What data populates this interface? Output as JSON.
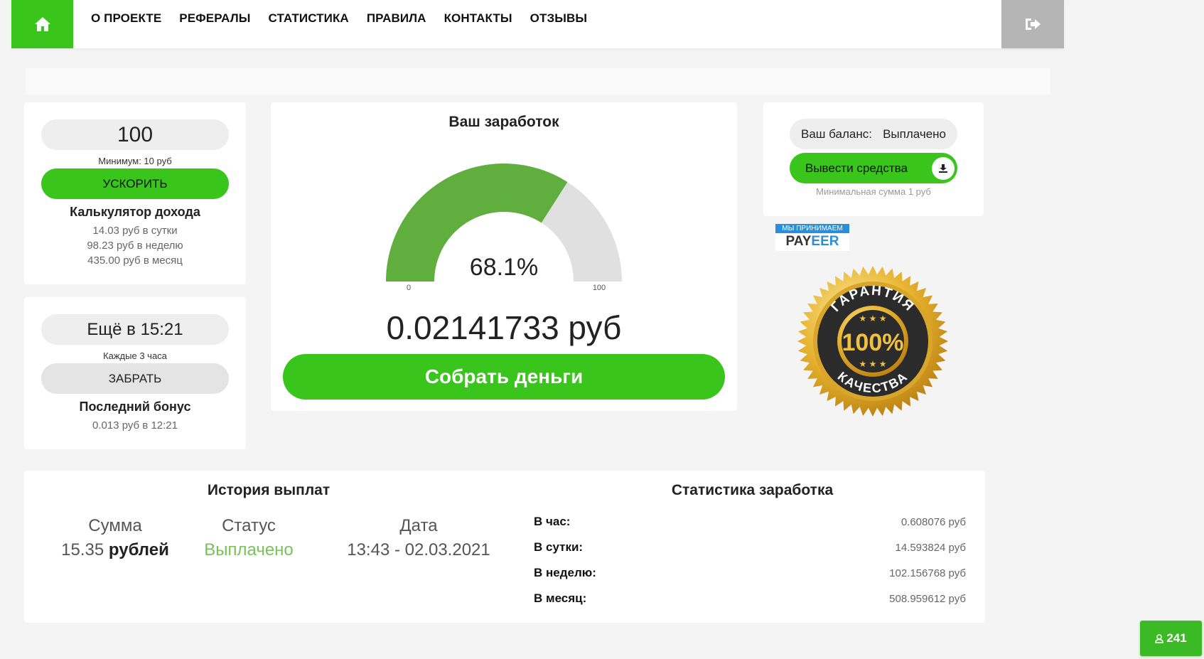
{
  "nav": {
    "home_icon": "home-icon",
    "items": [
      "О ПРОЕКТЕ",
      "РЕФЕРАЛЫ",
      "СТАТИСТИКА",
      "ПРАВИЛА",
      "КОНТАКТЫ",
      "ОТЗЫВЫ"
    ],
    "logout_icon": "sign-out-icon"
  },
  "boost": {
    "value": "100",
    "min_note": "Минимум: 10 руб",
    "button": "УСКОРИТЬ",
    "calc_title": "Калькулятор дохода",
    "per_day": "14.03 руб в сутки",
    "per_week": "98.23 руб в неделю",
    "per_month": "435.00 руб в месяц"
  },
  "bonus": {
    "timer": "Ещё в 15:21",
    "period_note": "Каждые 3 часа",
    "button": "ЗАБРАТЬ",
    "last_title": "Последний бонус",
    "last_value": "0.013 руб в 12:21"
  },
  "earnings": {
    "title": "Ваш заработок",
    "gauge_percent": 68.1,
    "gauge_label": "68.1%",
    "gauge_min": "0",
    "gauge_max": "100",
    "amount": "0.02141733 руб",
    "collect_button": "Собрать деньги",
    "colors": {
      "fill": "#5fae3e",
      "track": "#e0e0e0"
    }
  },
  "balance": {
    "label": "Ваш баланс:",
    "paid_label": "Выплачено",
    "withdraw_button": "Вывести средства",
    "withdraw_icon": "download-icon",
    "min_note": "Минимальная сумма 1 руб"
  },
  "payeer": {
    "top": "МЫ ПРИНИМАЕМ",
    "brand_a": "PAY",
    "brand_b": "EER"
  },
  "guarantee": {
    "top_text": "ГАРАНТИЯ",
    "center_text": "100%",
    "bottom_text": "КАЧЕСТВА"
  },
  "history": {
    "title": "История выплат",
    "columns": [
      "Сумма",
      "Статус",
      "Дата"
    ],
    "row": {
      "amount_num": "15.35",
      "amount_unit": "рублей",
      "status": "Выплачено",
      "date": "13:43 - 02.03.2021"
    }
  },
  "stats": {
    "title": "Статистика заработка",
    "rows": [
      {
        "label": "В час:",
        "value": "0.608076 руб"
      },
      {
        "label": "В сутки:",
        "value": "14.593824 руб"
      },
      {
        "label": "В неделю:",
        "value": "102.156768 руб"
      },
      {
        "label": "В месяц:",
        "value": "508.959612 руб"
      }
    ]
  },
  "online_badge": {
    "icon": "user-icon",
    "count": "241"
  }
}
